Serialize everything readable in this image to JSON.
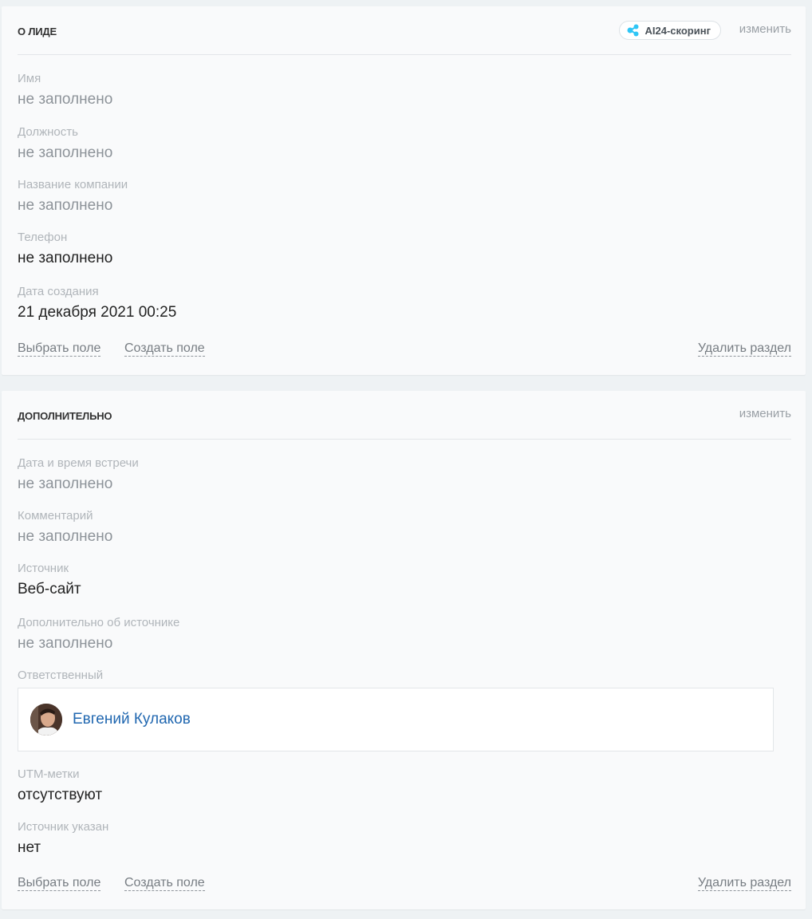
{
  "section1": {
    "title": "О ЛИДЕ",
    "ai_badge": "AI24-скоринг",
    "change": "изменить",
    "fields": [
      {
        "label": "Имя",
        "value": "не заполнено"
      },
      {
        "label": "Должность",
        "value": "не заполнено"
      },
      {
        "label": "Название компании",
        "value": "не заполнено"
      },
      {
        "label": "Телефон",
        "value": "не заполнено"
      },
      {
        "label": "Дата создания",
        "value": "21 декабря 2021 00:25"
      }
    ],
    "footer": {
      "select_field": "Выбрать поле",
      "create_field": "Создать поле",
      "delete_section": "Удалить раздел"
    }
  },
  "section2": {
    "title": "ДОПОЛНИТЕЛЬНО",
    "change": "изменить",
    "fields": [
      {
        "label": "Дата и время встречи",
        "value": "не заполнено"
      },
      {
        "label": "Комментарий",
        "value": "не заполнено"
      },
      {
        "label": "Источник",
        "value": "Веб-сайт"
      },
      {
        "label": "Дополнительно об источнике",
        "value": "не заполнено"
      }
    ],
    "responsible": {
      "label": "Ответственный",
      "name": "Евгений Кулаков"
    },
    "fields_after": [
      {
        "label": "UTM-метки",
        "value": "отсутствуют"
      },
      {
        "label": "Источник указан",
        "value": "нет"
      }
    ],
    "footer": {
      "select_field": "Выбрать поле",
      "create_field": "Создать поле",
      "delete_section": "Удалить раздел"
    }
  },
  "colors": {
    "accent_link": "#2067b0",
    "badge_icon": "#2fc6f6",
    "muted": "#b0b5ba"
  },
  "icons": {
    "ai_badge": "ai-scoring-icon",
    "avatar": "user-avatar"
  }
}
